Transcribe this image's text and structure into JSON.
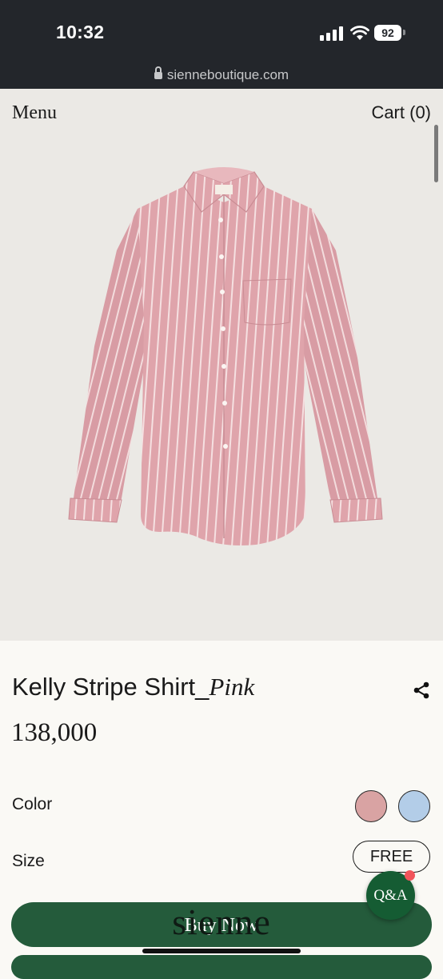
{
  "status_bar": {
    "time": "10:32",
    "battery": "92"
  },
  "browser": {
    "url": "sienneboutique.com"
  },
  "nav": {
    "menu": "Menu",
    "cart": "Cart (0)"
  },
  "product": {
    "name": "Kelly Stripe Shirt_",
    "variant": "Pink",
    "price": "138,000",
    "image_desc_icon": "pink-striped-shirt-image"
  },
  "options": {
    "color_label": "Color",
    "colors": [
      "#d9a3a3",
      "#b3cde8"
    ],
    "size_label": "Size",
    "size_value": "FREE"
  },
  "actions": {
    "buy_now": "Buy Now",
    "qa": "Q&A"
  },
  "brand": {
    "watermark": "sienne"
  }
}
